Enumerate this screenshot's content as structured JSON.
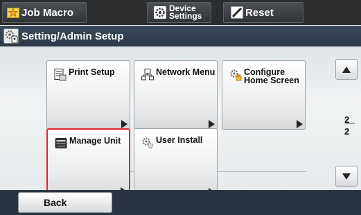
{
  "topbar": {
    "job_macro": {
      "label": "Job Macro",
      "icon": "star-icon"
    },
    "device_settings": {
      "label_line1": "Device",
      "label_line2": "Settings",
      "icon": "gear-icon"
    },
    "reset": {
      "label": "Reset",
      "icon": "reset-icon"
    }
  },
  "title": {
    "text": "Setting/Admin Setup",
    "icon": "admin-gear-icon"
  },
  "tiles": [
    {
      "label": "Print Setup",
      "icon": "document-icon"
    },
    {
      "label": "Network Menu",
      "icon": "network-icon"
    },
    {
      "label": "Configure Home Screen",
      "icon": "home-gear-icon"
    },
    {
      "label": "Manage Unit",
      "icon": "printer-icon",
      "selected": true
    },
    {
      "label": "User Install",
      "icon": "gears-icon"
    }
  ],
  "pager": {
    "current": "2",
    "total": "2"
  },
  "footer": {
    "back_label": "Back"
  },
  "colors": {
    "selection_border": "#e0262b",
    "topbar_bg": "#2b2d2f",
    "titlebar_bg": "#3b4a5b"
  }
}
